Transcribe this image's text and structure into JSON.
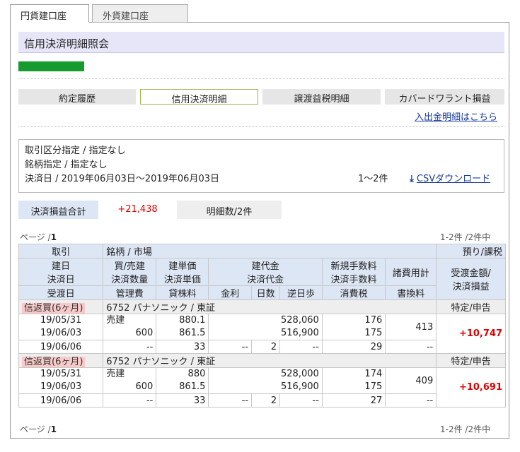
{
  "tabs": [
    "円貨建口座",
    "外貨建口座"
  ],
  "page_title": "信用決済明細照会",
  "subnav": [
    "約定履歴",
    "信用決済明細",
    "譲渡益税明細",
    "カバードワラント損益"
  ],
  "deposit_link": "入出金明細はこちら",
  "filter": {
    "line1": "取引区分指定 / 指定なし",
    "line2": "銘柄指定 /  指定なし",
    "line3": "決済日 / 2019年06月03日～2019年06月03日",
    "count": "1～2件",
    "csv_label": "CSVダウンロード",
    "csv_icon": "download-icon"
  },
  "summary": {
    "pl_label": "決済損益合計",
    "pl_value": "+21,438",
    "detail_count": "明細数/2件"
  },
  "pager": {
    "page_label": "ページ /",
    "page_no": "1",
    "range": "1-2件 /2件中"
  },
  "headers": {
    "row1": [
      "取引",
      "銘柄 / 市場",
      "預り/課税"
    ],
    "row2": [
      "建日\n決済日",
      "買/売建\n決済数量",
      "建単価\n決済単価",
      "建代金\n決済代金",
      "新規手数料\n決済手数料",
      "諸費用計",
      "受渡金額/\n決済損益"
    ],
    "row3": [
      "受渡日",
      "管理費",
      "貸株料",
      "金利",
      "日数",
      "逆日歩",
      "消費税",
      "書換料"
    ]
  },
  "records": [
    {
      "trade": "信返買(6ヶ月)",
      "stock": "6752 パナソニック / 東証",
      "account": "特定/申告",
      "open_date": "19/05/31",
      "close_date": "19/06/03",
      "delivery_date": "19/06/06",
      "side": "売建",
      "qty": "600",
      "mgmt_fee": "--",
      "open_price": "880.1",
      "close_price": "861.5",
      "lending_fee": "33",
      "open_amount": "528,060",
      "close_amount": "516,900",
      "interest": "--",
      "days": "2",
      "reverse_fee": "--",
      "new_fee": "176",
      "close_fee": "175",
      "tax": "29",
      "total_cost": "413",
      "rewrite_fee": "--",
      "pl": "+10,747"
    },
    {
      "trade": "信返買(6ヶ月)",
      "stock": "6752 パナソニック / 東証",
      "account": "特定/申告",
      "open_date": "19/05/31",
      "close_date": "19/06/03",
      "delivery_date": "19/06/06",
      "side": "売建",
      "qty": "600",
      "mgmt_fee": "--",
      "open_price": "880",
      "close_price": "861.5",
      "lending_fee": "33",
      "open_amount": "528,000",
      "close_amount": "516,900",
      "interest": "--",
      "days": "2",
      "reverse_fee": "--",
      "new_fee": "174",
      "close_fee": "175",
      "tax": "27",
      "total_cost": "409",
      "rewrite_fee": "--",
      "pl": "+10,691"
    }
  ]
}
